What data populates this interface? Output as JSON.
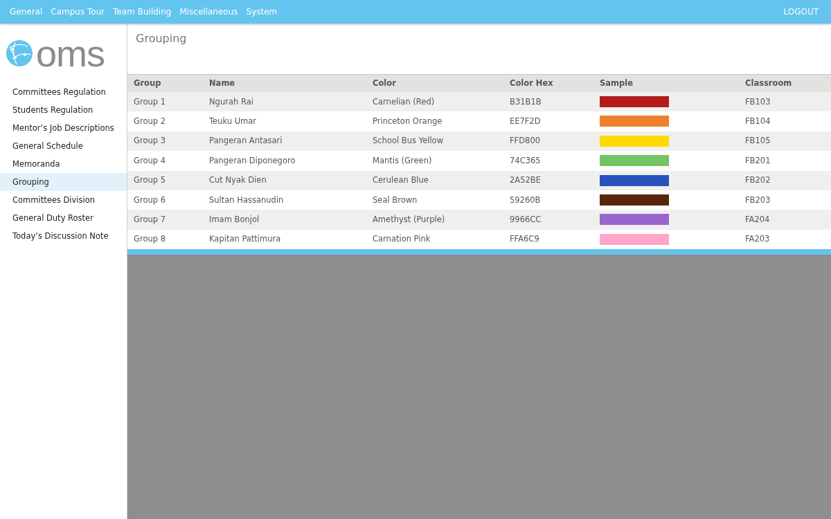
{
  "top_menu": [
    {
      "label": "General"
    },
    {
      "label": "Campus Tour"
    },
    {
      "label": "Team Building"
    },
    {
      "label": "Miscellaneous"
    },
    {
      "label": "System"
    }
  ],
  "logout": "LOGOUT",
  "logo_text": "oms",
  "sidebar": {
    "items": [
      {
        "label": "Committees Regulation",
        "selected": false
      },
      {
        "label": "Students Regulation",
        "selected": false
      },
      {
        "label": "Mentor’s Job Descriptions",
        "selected": false
      },
      {
        "label": "General Schedule",
        "selected": false
      },
      {
        "label": "Memoranda",
        "selected": false
      },
      {
        "label": "Grouping",
        "selected": true
      },
      {
        "label": "Committees Division",
        "selected": false
      },
      {
        "label": "General Duty Roster",
        "selected": false
      },
      {
        "label": "Today’s Discussion Note",
        "selected": false
      }
    ]
  },
  "page_title": "Grouping",
  "table": {
    "columns": [
      "Group",
      "Name",
      "Color",
      "Color Hex",
      "Sample",
      "Classroom"
    ],
    "rows": [
      {
        "group": "Group 1",
        "name": "Ngurah Rai",
        "color_name": "Carnelian (Red)",
        "hex": "B31B1B",
        "color": "#b31b1b",
        "classroom": "FB103"
      },
      {
        "group": "Group 2",
        "name": "Teuku Umar",
        "color_name": "Princeton Orange",
        "hex": "EE7F2D",
        "color": "#ee7f2d",
        "classroom": "FB104"
      },
      {
        "group": "Group 3",
        "name": "Pangeran Antasari",
        "color_name": "School Bus Yellow",
        "hex": "FFD800",
        "color": "#ffd800",
        "classroom": "FB105"
      },
      {
        "group": "Group 4",
        "name": "Pangeran Diponegoro",
        "color_name": "Mantis (Green)",
        "hex": "74C365",
        "color": "#74c365",
        "classroom": "FB201"
      },
      {
        "group": "Group 5",
        "name": "Cut Nyak Dien",
        "color_name": "Cerulean Blue",
        "hex": "2A52BE",
        "color": "#2a52be",
        "classroom": "FB202"
      },
      {
        "group": "Group 6",
        "name": "Sultan Hassanudin",
        "color_name": "Seal Brown",
        "hex": "59260B",
        "color": "#59260b",
        "classroom": "FB203"
      },
      {
        "group": "Group 7",
        "name": "Imam Bonjol",
        "color_name": "Amethyst (Purple)",
        "hex": "9966CC",
        "color": "#9966cc",
        "classroom": "FA204"
      },
      {
        "group": "Group 8",
        "name": "Kapitan Pattimura",
        "color_name": "Carnation Pink",
        "hex": "FFA6C9",
        "color": "#ffa6c9",
        "classroom": "FA203"
      }
    ]
  }
}
